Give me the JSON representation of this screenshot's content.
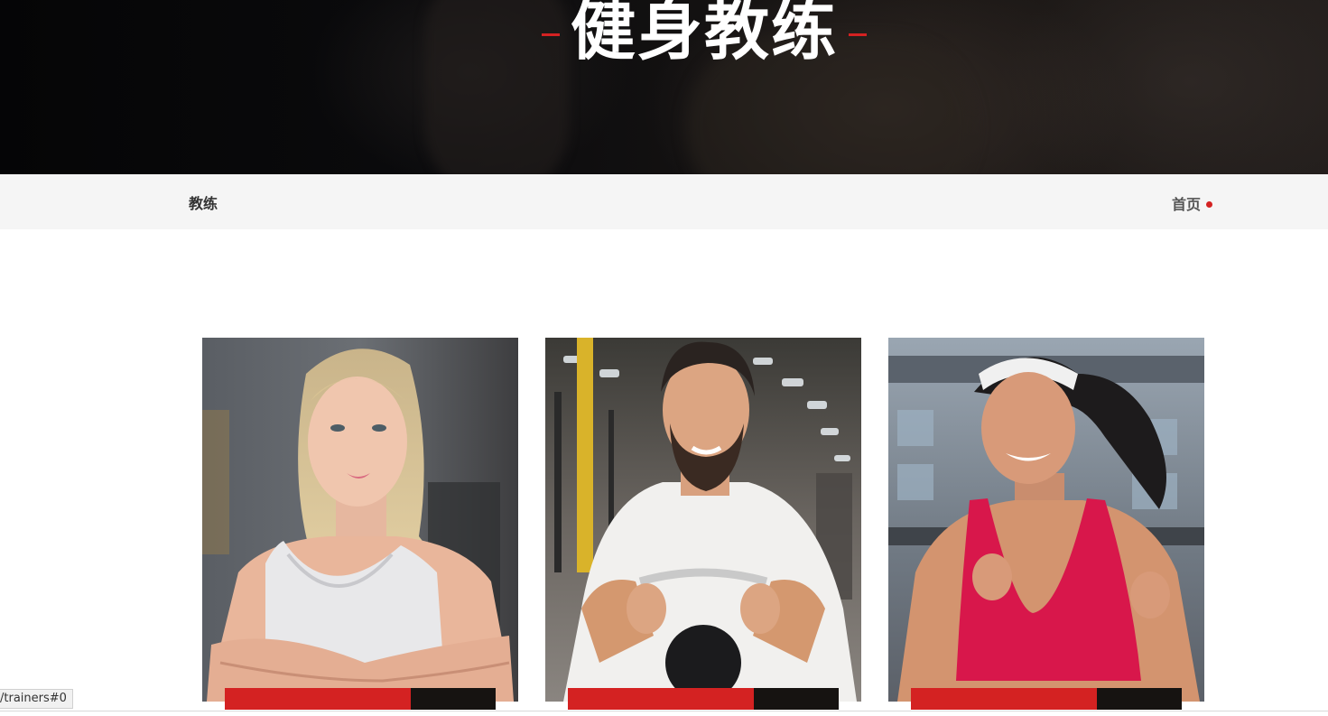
{
  "hero": {
    "title": "健身教练"
  },
  "breadcrumb": {
    "current": "教练",
    "home": "首页"
  },
  "trainers": [
    {
      "photo": "trainer-female-white-top"
    },
    {
      "photo": "trainer-male-kettlebell"
    },
    {
      "photo": "trainer-female-running"
    }
  ],
  "status_bar": {
    "url": "/trainers#0"
  },
  "colors": {
    "accent": "#d42222",
    "dark": "#161311",
    "crumb_bg": "#f5f5f5"
  }
}
